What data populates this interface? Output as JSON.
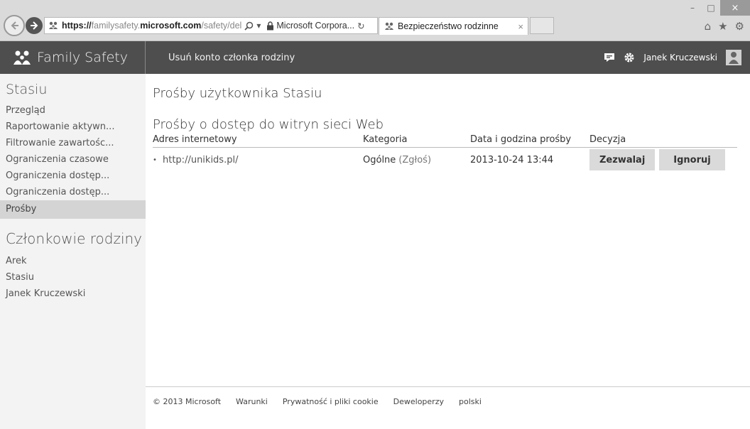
{
  "browser": {
    "url_scheme": "https://",
    "url_pre": "familysafety.",
    "url_domain": "microsoft.com",
    "url_path": "/safety/del",
    "cert_label": "Microsoft Corpora...",
    "tab_title": "Bezpieczeństwo rodzinne",
    "tab_close": "×"
  },
  "header": {
    "brand": "Family Safety",
    "remove_link": "Usuń konto członka rodziny",
    "user_name": "Janek Kruczewski"
  },
  "sidebar": {
    "member_title": "Stasiu",
    "items": [
      {
        "label": "Przegląd"
      },
      {
        "label": "Raportowanie aktywn..."
      },
      {
        "label": "Filtrowanie zawartośc..."
      },
      {
        "label": "Ograniczenia czasowe"
      },
      {
        "label": "Ograniczenia dostęp..."
      },
      {
        "label": "Ograniczenia dostęp..."
      },
      {
        "label": "Prośby",
        "selected": true
      }
    ],
    "members_title": "Członkowie rodziny",
    "members": [
      {
        "label": "Arek"
      },
      {
        "label": "Stasiu"
      },
      {
        "label": "Janek Kruczewski"
      }
    ]
  },
  "main": {
    "page_title": "Prośby użytkownika Stasiu",
    "section_title": "Prośby o dostęp do witryn sieci Web",
    "columns": [
      "Adres internetowy",
      "Kategoria",
      "Data i godzina prośby",
      "Decyzja"
    ],
    "rows": [
      {
        "url": "http://unikids.pl/",
        "category": "Ogólne",
        "category_action": "(Zgłoś)",
        "datetime": "2013-10-24 13:44",
        "allow_label": "Zezwalaj",
        "ignore_label": "Ignoruj"
      }
    ]
  },
  "footer": {
    "links": [
      "© 2013 Microsoft",
      "Warunki",
      "Prywatność i pliki cookie",
      "Deweloperzy",
      "polski"
    ]
  },
  "colors": {
    "header_bg": "#4e4e4e",
    "sidebar_bg": "#f3f3f3",
    "selected_bg": "#d4d4d4",
    "button_bg": "#dadada"
  }
}
